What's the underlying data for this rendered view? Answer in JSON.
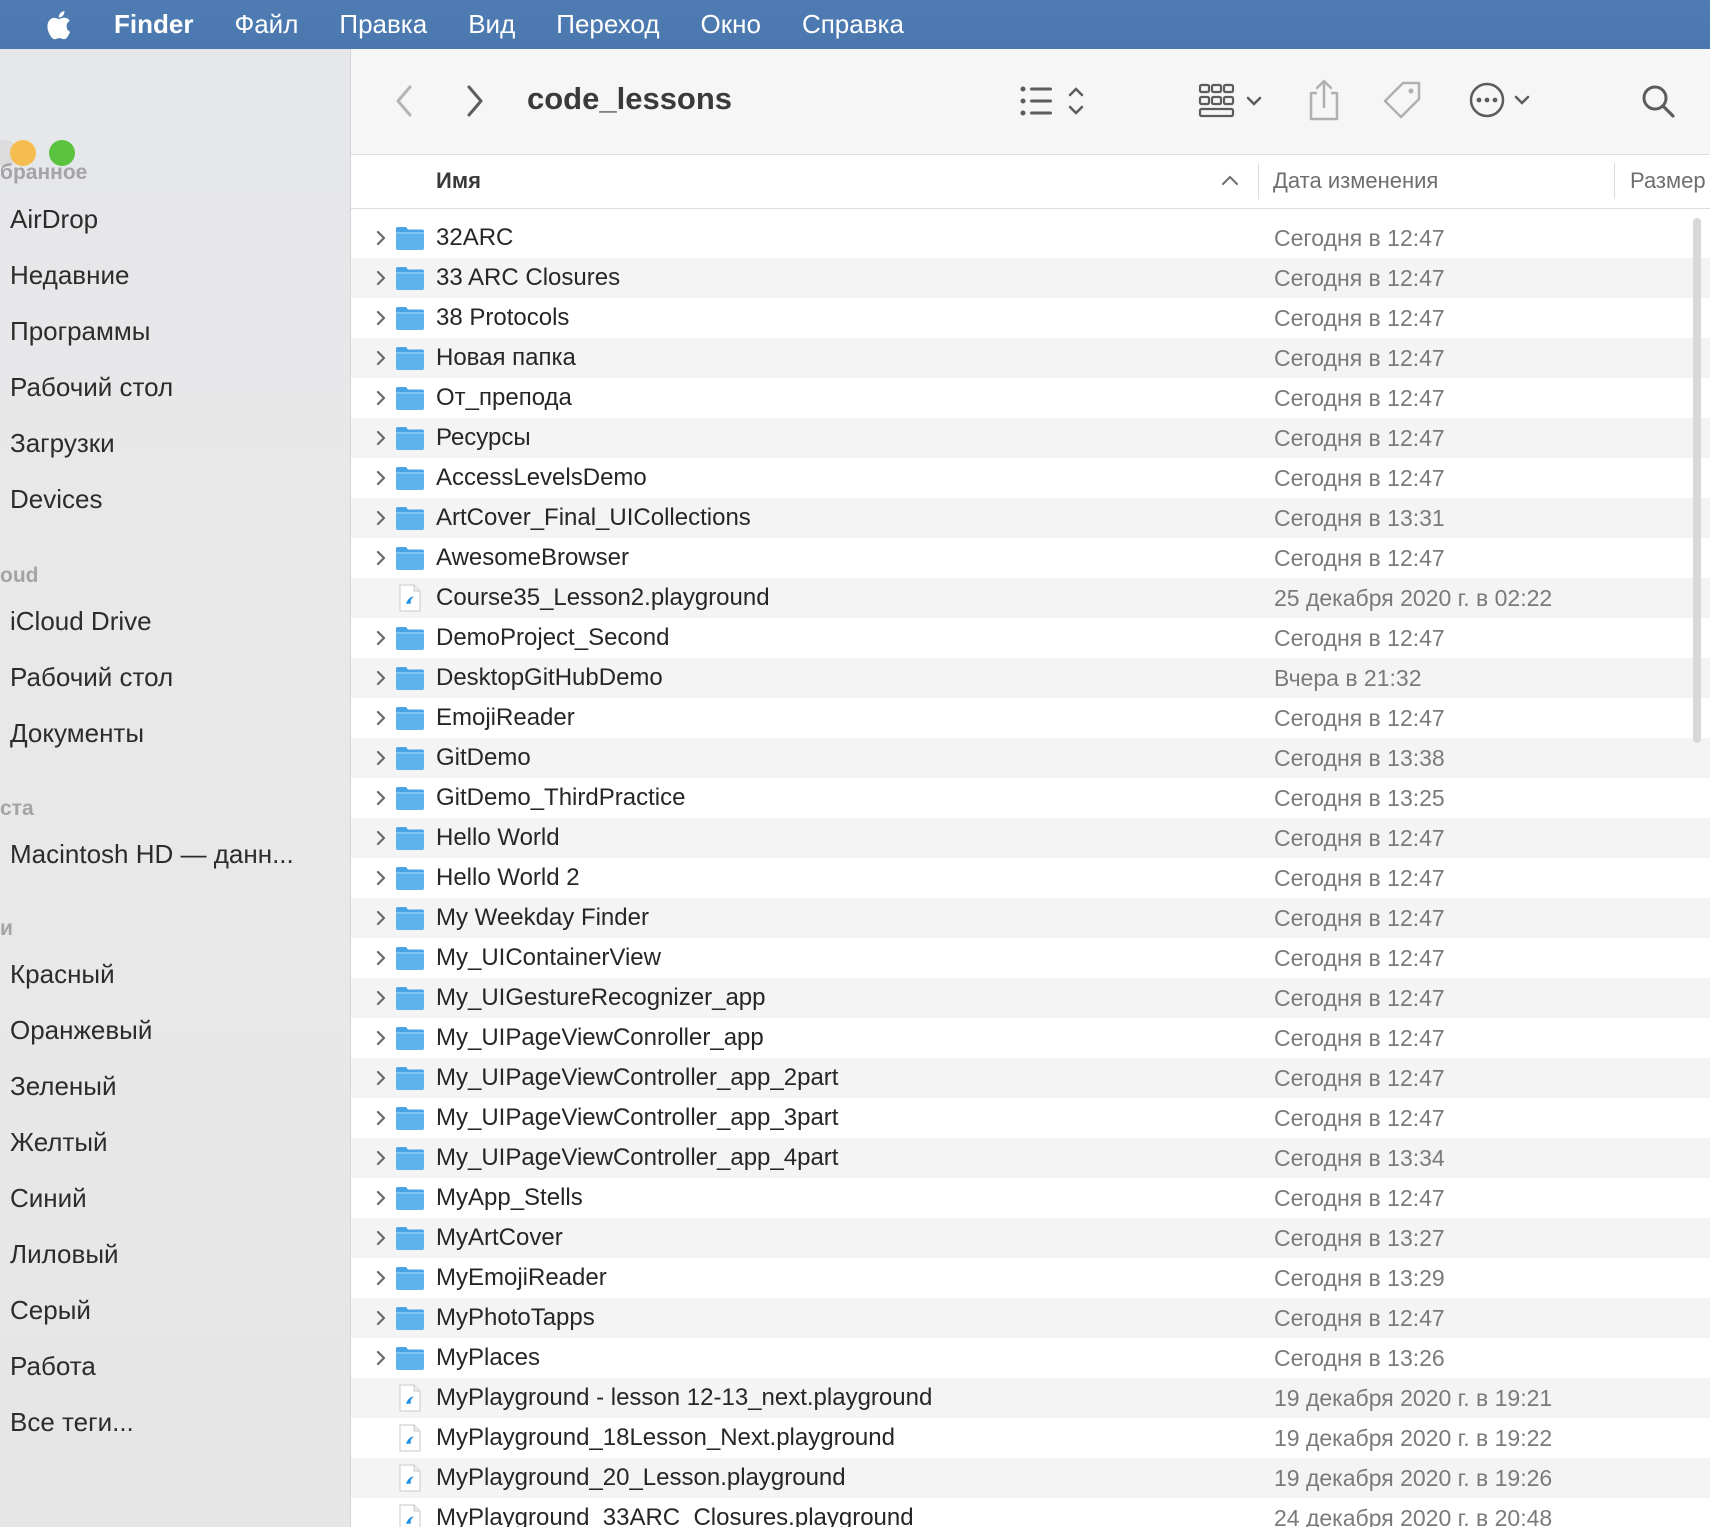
{
  "menubar": {
    "app_name": "Finder",
    "items": [
      "Файл",
      "Правка",
      "Вид",
      "Переход",
      "Окно",
      "Справка"
    ]
  },
  "sidebar": {
    "favorites_header": "бранное",
    "favorites": [
      "AirDrop",
      "Недавние",
      "Программы",
      "Рабочий стол",
      "Загрузки",
      "Devices"
    ],
    "icloud_header": "oud",
    "icloud": [
      "iCloud Drive",
      "Рабочий стол",
      "Документы"
    ],
    "locations_header": "ста",
    "locations": [
      "Macintosh HD — данн..."
    ],
    "tags_header": "и",
    "tags": [
      "Красный",
      "Оранжевый",
      "Зеленый",
      "Желтый",
      "Синий",
      "Лиловый",
      "Серый",
      "Работа",
      "Все теги..."
    ]
  },
  "toolbar": {
    "title": "code_lessons",
    "icons": [
      "back-chevron-icon",
      "forward-chevron-icon",
      "list-view-icon",
      "group-icon",
      "share-icon",
      "tag-icon",
      "more-icon",
      "search-icon"
    ]
  },
  "columns": {
    "name": "Имя",
    "date": "Дата изменения",
    "size": "Размер"
  },
  "files": [
    {
      "name": "32ARC",
      "date": "Сегодня в 12:47",
      "type": "folder"
    },
    {
      "name": "33 ARC Closures",
      "date": "Сегодня в 12:47",
      "type": "folder"
    },
    {
      "name": "38 Protocols",
      "date": "Сегодня в 12:47",
      "type": "folder"
    },
    {
      "name": "Новая папка",
      "date": "Сегодня в 12:47",
      "type": "folder"
    },
    {
      "name": "От_препода",
      "date": "Сегодня в 12:47",
      "type": "folder"
    },
    {
      "name": "Ресурсы",
      "date": "Сегодня в 12:47",
      "type": "folder"
    },
    {
      "name": "AccessLevelsDemo",
      "date": "Сегодня в 12:47",
      "type": "folder"
    },
    {
      "name": "ArtCover_Final_UICollections",
      "date": "Сегодня в 13:31",
      "type": "folder"
    },
    {
      "name": "AwesomeBrowser",
      "date": "Сегодня в 12:47",
      "type": "folder"
    },
    {
      "name": "Course35_Lesson2.playground",
      "date": "25 декабря 2020 г. в 02:22",
      "type": "file"
    },
    {
      "name": "DemoProject_Second",
      "date": "Сегодня в 12:47",
      "type": "folder"
    },
    {
      "name": "DesktopGitHubDemo",
      "date": "Вчера в 21:32",
      "type": "folder"
    },
    {
      "name": "EmojiReader",
      "date": "Сегодня в 12:47",
      "type": "folder"
    },
    {
      "name": "GitDemo",
      "date": "Сегодня в 13:38",
      "type": "folder"
    },
    {
      "name": "GitDemo_ThirdPractice",
      "date": "Сегодня в 13:25",
      "type": "folder"
    },
    {
      "name": "Hello World",
      "date": "Сегодня в 12:47",
      "type": "folder"
    },
    {
      "name": "Hello World 2",
      "date": "Сегодня в 12:47",
      "type": "folder"
    },
    {
      "name": "My Weekday Finder",
      "date": "Сегодня в 12:47",
      "type": "folder"
    },
    {
      "name": "My_UIContainerView",
      "date": "Сегодня в 12:47",
      "type": "folder"
    },
    {
      "name": "My_UIGestureRecognizer_app",
      "date": "Сегодня в 12:47",
      "type": "folder"
    },
    {
      "name": "My_UIPageViewConroller_app",
      "date": "Сегодня в 12:47",
      "type": "folder"
    },
    {
      "name": "My_UIPageViewController_app_2part",
      "date": "Сегодня в 12:47",
      "type": "folder"
    },
    {
      "name": "My_UIPageViewController_app_3part",
      "date": "Сегодня в 12:47",
      "type": "folder"
    },
    {
      "name": "My_UIPageViewController_app_4part",
      "date": "Сегодня в 13:34",
      "type": "folder"
    },
    {
      "name": "MyApp_Stells",
      "date": "Сегодня в 12:47",
      "type": "folder"
    },
    {
      "name": "MyArtCover",
      "date": "Сегодня в 13:27",
      "type": "folder"
    },
    {
      "name": "MyEmojiReader",
      "date": "Сегодня в 13:29",
      "type": "folder"
    },
    {
      "name": "MyPhotoTapps",
      "date": "Сегодня в 12:47",
      "type": "folder"
    },
    {
      "name": "MyPlaces",
      "date": "Сегодня в 13:26",
      "type": "folder"
    },
    {
      "name": "MyPlayground - lesson 12-13_next.playground",
      "date": "19 декабря 2020 г. в 19:21",
      "type": "file"
    },
    {
      "name": "MyPlayground_18Lesson_Next.playground",
      "date": "19 декабря 2020 г. в 19:22",
      "type": "file"
    },
    {
      "name": "MyPlayground_20_Lesson.playground",
      "date": "19 декабря 2020 г. в 19:26",
      "type": "file"
    },
    {
      "name": "MyPlayground_33ARC_Closures.playground",
      "date": "24 декабря 2020 г. в 20:48",
      "type": "file"
    }
  ],
  "colors": {
    "menubar": "#4a77ad",
    "folder": "#5fb3ec",
    "close": "#e6e6e6",
    "minimize": "#f5bd4f",
    "zoom": "#5ac33f"
  }
}
